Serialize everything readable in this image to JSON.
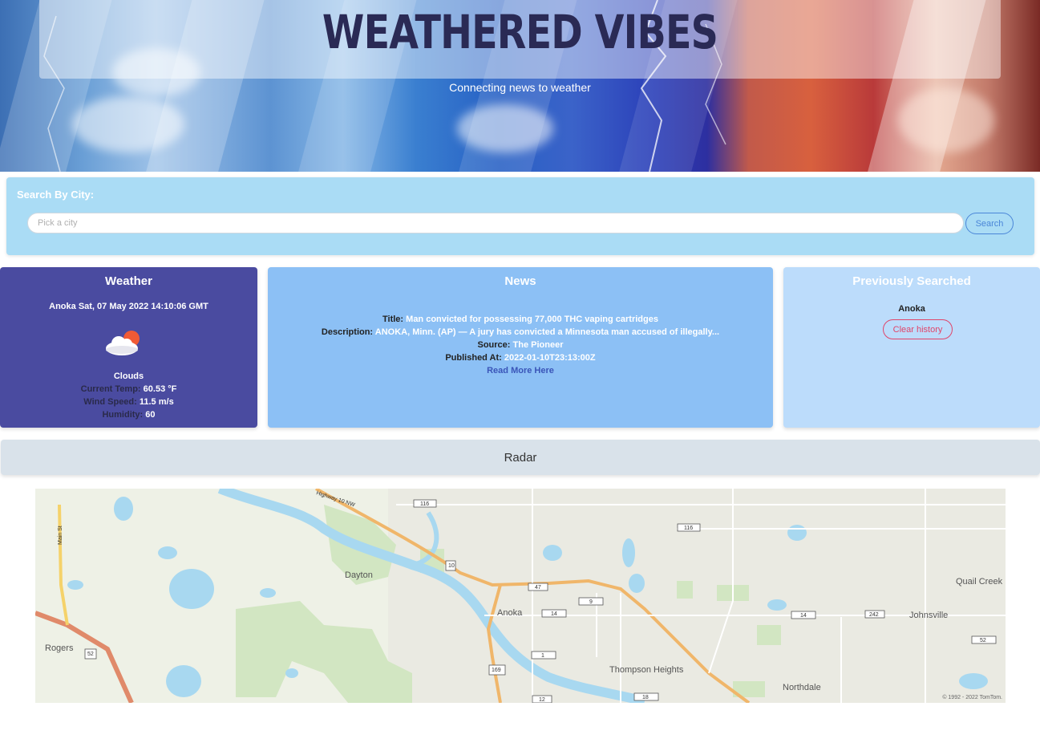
{
  "header": {
    "title": "WEATHERED VIBES",
    "tagline": "Connecting news to weather"
  },
  "search": {
    "label": "Search By City:",
    "placeholder": "Pick a city",
    "value": "",
    "button_label": "Search"
  },
  "weather": {
    "title": "Weather",
    "city_datetime": "Anoka Sat, 07 May 2022 14:10:06 GMT",
    "icon": "cloud-sun-icon",
    "condition": "Clouds",
    "temp_label": "Current Temp:",
    "temp_value": "60.53 °F",
    "wind_label": "Wind Speed:",
    "wind_value": "11.5 m/s",
    "humidity_label": "Humidity:",
    "humidity_value": "60"
  },
  "news": {
    "title": "News",
    "title_label": "Title:",
    "title_value": "Man convicted for possessing 77,000 THC vaping cartridges",
    "description_label": "Description:",
    "description_value": "ANOKA, Minn. (AP) — A jury has convicted a Minnesota man accused of illegally...",
    "source_label": "Source:",
    "source_value": "The Pioneer",
    "published_label": "Published At:",
    "published_value": "2022-01-10T23:13:00Z",
    "link_label": "Read More Here"
  },
  "history": {
    "title": "Previously Searched",
    "items": [
      "Anoka"
    ],
    "clear_label": "Clear history"
  },
  "radar": {
    "title": "Radar",
    "copyright": "© 1992 - 2022 TomTom.",
    "places": [
      "Dayton",
      "Anoka",
      "Rogers",
      "Thompson Heights",
      "Northdale",
      "Quail Creek",
      "Johnsville"
    ],
    "road_labels": [
      "116",
      "10",
      "47",
      "9",
      "14",
      "242",
      "52",
      "169",
      "1",
      "12",
      "18",
      "Main St",
      "Highway 10 NW"
    ]
  },
  "colors": {
    "weather_card": "#4a4ba0",
    "news_card": "#8cc0f5",
    "history_card": "#bcdcfb",
    "search_panel": "#aadcf5",
    "radar_bar": "#d9e2ea",
    "accent_link": "#3a55b8",
    "clear_button": "#e0456a"
  }
}
